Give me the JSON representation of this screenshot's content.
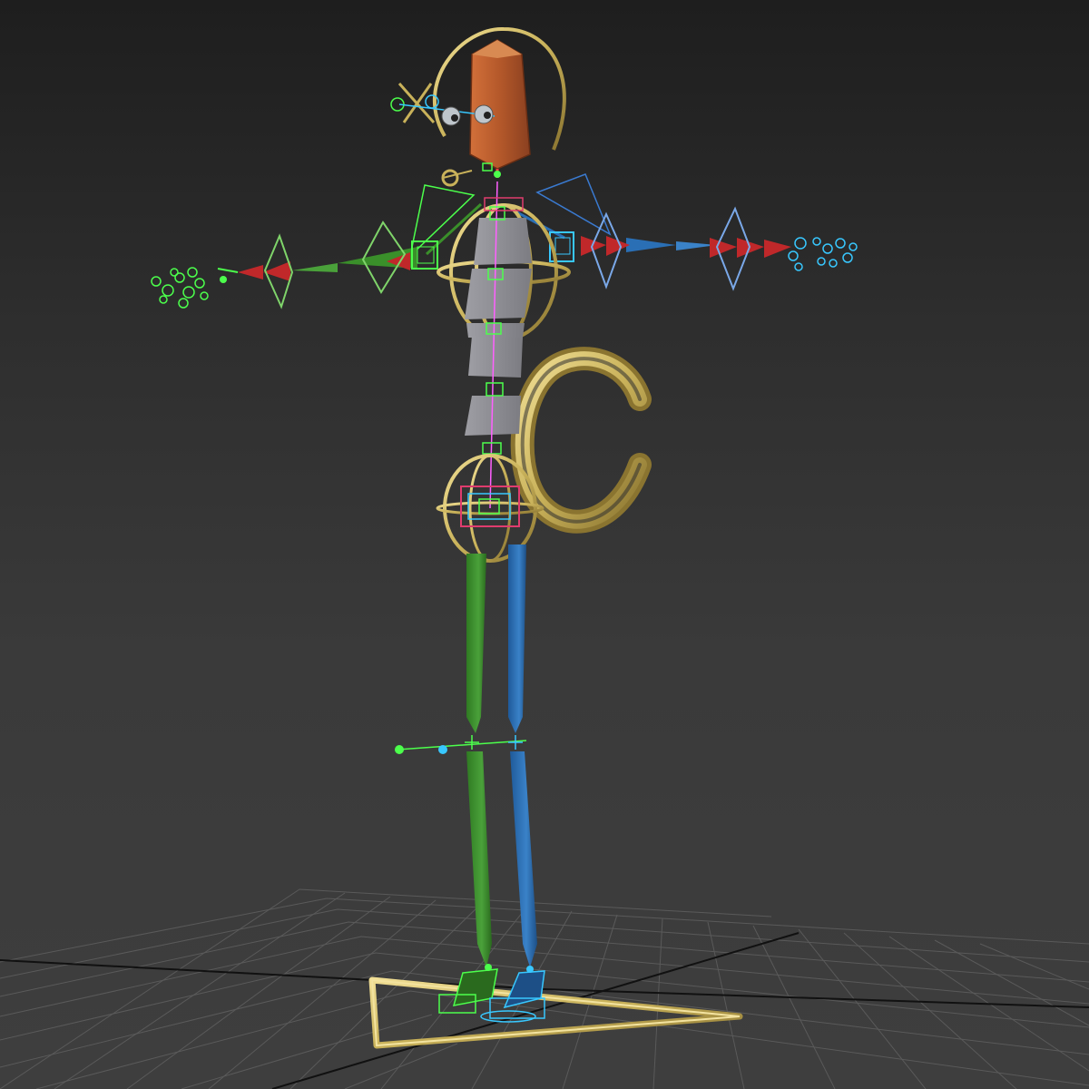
{
  "viewport": {
    "name": "perspective-viewport",
    "background_top": "#1e1e1e",
    "background_bottom": "#3e3e3e"
  },
  "colors": {
    "grid": "#5a5a5a",
    "grid_axis": "#111111",
    "rig_gold": "#c9b25a",
    "left_side": "#3a8f2a",
    "left_helpers": "#4cff4c",
    "right_side": "#2a6fb5",
    "right_helpers": "#38c8ff",
    "head": "#b4582a",
    "spine": "#8a8a8e",
    "ik_red": "#c0282a",
    "hip_frame": "#e03c6e",
    "spline": "#ff60ff"
  },
  "icons": [
    "head-bone-icon",
    "look-at-ring-icon",
    "eye-target-icon",
    "shoulder-circle-icon",
    "hip-circle-icon",
    "cog-c-shape-icon",
    "foot-ik-triangle-icon",
    "knee-pole-icon",
    "finger-controls-icon"
  ]
}
